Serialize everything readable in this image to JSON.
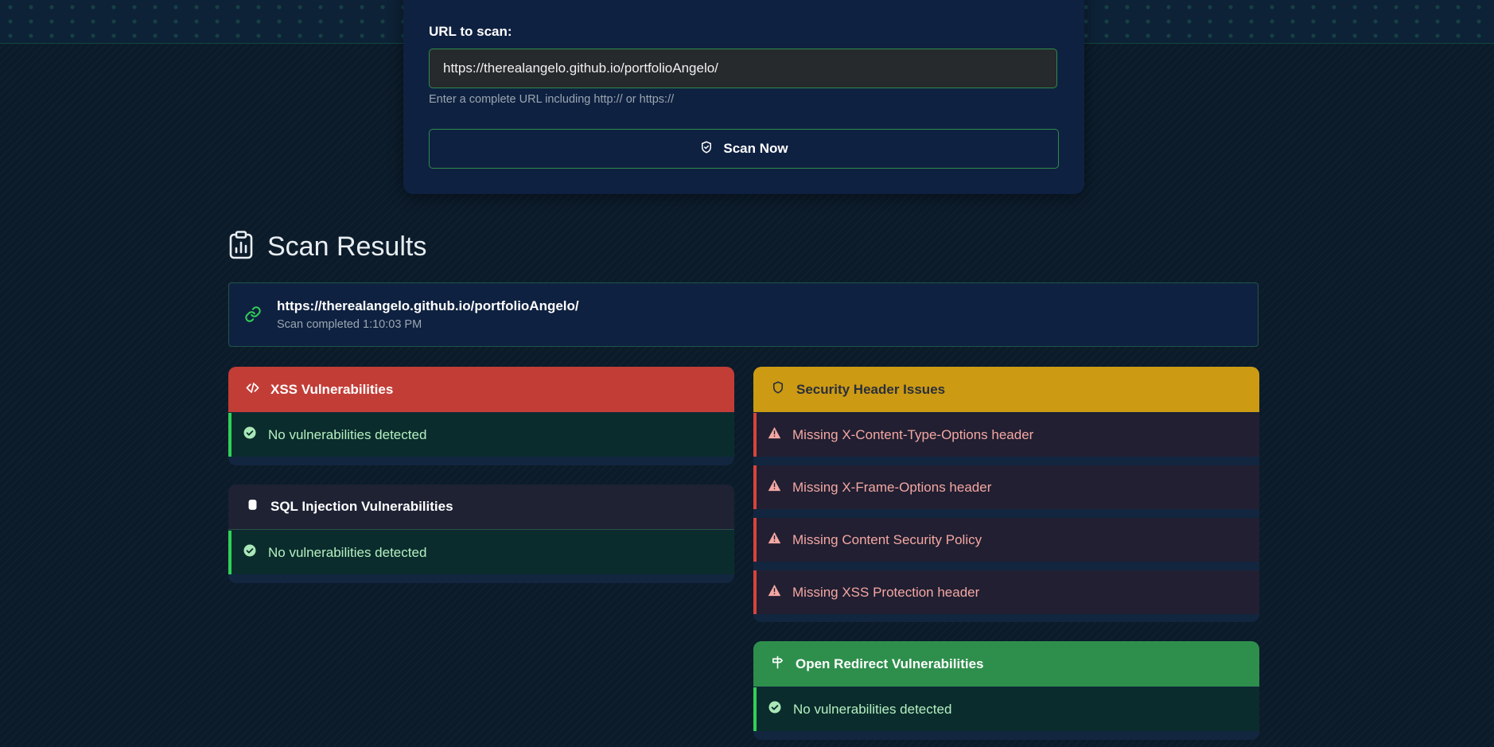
{
  "form": {
    "url_label": "URL to scan:",
    "url_value": "https://therealangelo.github.io/portfolioAngelo/",
    "url_hint": "Enter a complete URL including http:// or https://",
    "scan_button_label": "Scan Now",
    "scan_button_icon": "shield-check-icon"
  },
  "results": {
    "title": "Scan Results",
    "title_icon": "clipboard-chart-icon",
    "target_url": "https://therealangelo.github.io/portfolioAngelo/",
    "scan_time": "Scan completed 1:10:03 PM"
  },
  "cards": {
    "xss": {
      "title": "XSS Vulnerabilities",
      "icon": "code-icon",
      "color": "#c33d37",
      "items": [
        "No vulnerabilities detected"
      ]
    },
    "sql": {
      "title": "SQL Injection Vulnerabilities",
      "icon": "database-icon",
      "color": "#1e2233",
      "items": [
        "No vulnerabilities detected"
      ]
    },
    "headers": {
      "title": "Security Header Issues",
      "icon": "shield-icon",
      "color": "#cc9a13",
      "items": [
        "Missing X-Content-Type-Options header",
        "Missing X-Frame-Options header",
        "Missing Content Security Policy",
        "Missing XSS Protection header"
      ]
    },
    "redirect": {
      "title": "Open Redirect Vulnerabilities",
      "icon": "signpost-icon",
      "color": "#2e8f4c",
      "items": [
        "No vulnerabilities detected"
      ]
    }
  },
  "colors": {
    "success": "#30d158",
    "danger": "#d9433b",
    "accent_border": "#2e8b4c"
  }
}
